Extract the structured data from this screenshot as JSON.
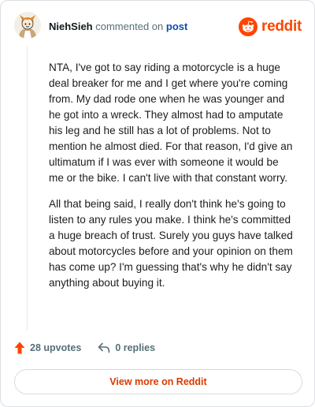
{
  "header": {
    "username": "NiehSieh",
    "action_text": "commented on",
    "post_link": "post",
    "brand": "reddit",
    "avatar_icon": "snoo-avatar-icon",
    "brand_icon": "reddit-logo-icon"
  },
  "comment": {
    "paragraphs": [
      "NTA, I've got to say riding a motorcycle is a huge deal breaker for me and I get where you're coming from. My dad rode one when he was younger and he got into a wreck. They almost had to amputate his leg and he still has a lot of problems. Not to mention he almost died. For that reason, I'd give an ultimatum if I was ever with someone it would be me or the bike. I can't live with that constant worry.",
      "All that being said, I really don't think he's going to listen to any rules you make. I think he's committed a huge breach of trust. Surely you guys have talked about motorcycles before and your opinion on them has come up? I'm guessing that's why he didn't say anything about buying it."
    ]
  },
  "actions": {
    "upvotes": "28 upvotes",
    "replies": "0 replies",
    "upvote_icon": "upvote-arrow-icon",
    "reply_icon": "reply-arrow-icon"
  },
  "footer": {
    "view_more": "View more on Reddit"
  },
  "colors": {
    "brand": "#ff4500",
    "link": "#0a4fb3",
    "view_more": "#d93a00",
    "muted": "#576f76"
  }
}
